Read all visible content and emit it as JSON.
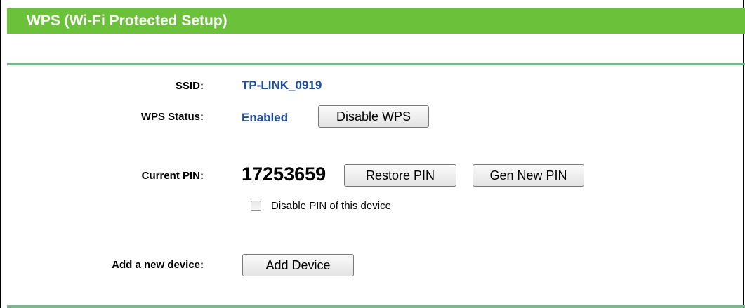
{
  "header": {
    "title": "WPS (Wi-Fi Protected Setup)",
    "accent_color": "#6cc13a"
  },
  "ssid": {
    "label": "SSID:",
    "value": "TP-LINK_0919"
  },
  "wps_status": {
    "label": "WPS Status:",
    "value": "Enabled",
    "button": "Disable WPS"
  },
  "pin": {
    "label": "Current PIN:",
    "value": "17253659",
    "restore_button": "Restore PIN",
    "gen_button": "Gen New PIN"
  },
  "disable_pin": {
    "label": "Disable PIN of this device",
    "checked": false
  },
  "add_device": {
    "label": "Add a new device:",
    "button": "Add Device"
  }
}
